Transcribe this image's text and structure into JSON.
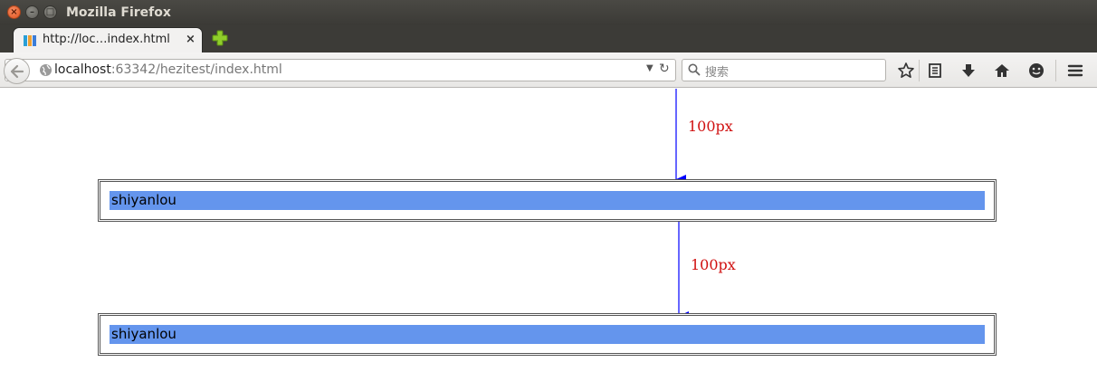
{
  "window": {
    "title": "Mozilla Firefox"
  },
  "tab": {
    "title": "http://loc…index.html",
    "close_icon": "×"
  },
  "navbar": {
    "url_host": "localhost",
    "url_rest": ":63342/hezitest/index.html",
    "search_placeholder": "搜索"
  },
  "page": {
    "boxes": [
      {
        "text": "shiyanlou"
      },
      {
        "text": "shiyanlou"
      }
    ],
    "annotations": [
      {
        "label": "100px"
      },
      {
        "label": "100px"
      }
    ]
  },
  "colors": {
    "inner_bg": "#6495ed",
    "arrow": "#0000ff",
    "annotation_text": "#d01010"
  }
}
